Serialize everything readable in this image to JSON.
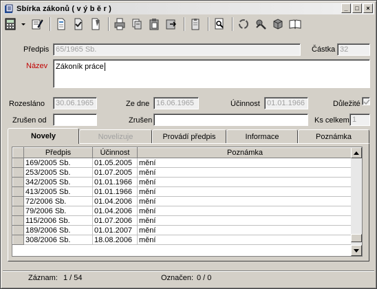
{
  "window": {
    "title": "Sbírka zákonů  ( v ý b ě r )"
  },
  "toolbar": {
    "icons": [
      "calculator-icon",
      "dropdown-arrow-icon",
      "edit-icon",
      "document-icon",
      "document-ok-icon",
      "document-check-icon",
      "print-icon",
      "copy-icon",
      "paste-icon",
      "export-icon",
      "clipboard-icon",
      "find-icon",
      "recycle-icon",
      "tools-icon",
      "box-icon",
      "book-icon"
    ]
  },
  "form": {
    "predpis_label": "Předpis",
    "predpis_value": "65/1965 Sb.",
    "castka_label": "Částka",
    "castka_value": "32",
    "nazev_label": "Název",
    "nazev_value": "Zákoník práce",
    "rozeslano_label": "Rozesláno",
    "rozeslano_value": "30.06.1965",
    "zedne_label": "Ze dne",
    "zedne_value": "16.06.1965",
    "ucinnost_label": "Účinnost",
    "ucinnost_value": "01.01.1966",
    "dulezite_label": "Důležité",
    "dulezite_checked": true,
    "zrusenod_label": "Zrušen od",
    "zrusenod_value": "",
    "zrusen_label": "Zrušen",
    "zrusen_value": "",
    "kscelkem_label": "Ks celkem",
    "kscelkem_value": "1"
  },
  "tabs": [
    {
      "label": "Novely",
      "active": true,
      "disabled": false
    },
    {
      "label": "Novelizuje",
      "active": false,
      "disabled": true
    },
    {
      "label": "Provádí předpis",
      "active": false,
      "disabled": false
    },
    {
      "label": "Informace",
      "active": false,
      "disabled": false
    },
    {
      "label": "Poznámka",
      "active": false,
      "disabled": false
    }
  ],
  "grid": {
    "columns": [
      "Předpis",
      "Účinnost",
      "Poznámka"
    ],
    "rows": [
      [
        "169/2005 Sb.",
        "01.05.2005",
        "mění"
      ],
      [
        "253/2005 Sb.",
        "01.07.2005",
        "mění"
      ],
      [
        "342/2005 Sb.",
        "01.01.1966",
        "mění"
      ],
      [
        "413/2005 Sb.",
        "01.01.1966",
        "mění"
      ],
      [
        "72/2006 Sb.",
        "01.04.2006",
        "mění"
      ],
      [
        "79/2006 Sb.",
        "01.04.2006",
        "mění"
      ],
      [
        "115/2006 Sb.",
        "01.07.2006",
        "mění"
      ],
      [
        "189/2006 Sb.",
        "01.01.2007",
        "mění"
      ],
      [
        "308/2006 Sb.",
        "18.08.2006",
        "mění"
      ]
    ]
  },
  "status": {
    "zaznam_label": "Záznam:",
    "zaznam_value": "1 / 54",
    "oznaceno_label": "Označen:",
    "oznaceno_value": "0 / 0"
  }
}
